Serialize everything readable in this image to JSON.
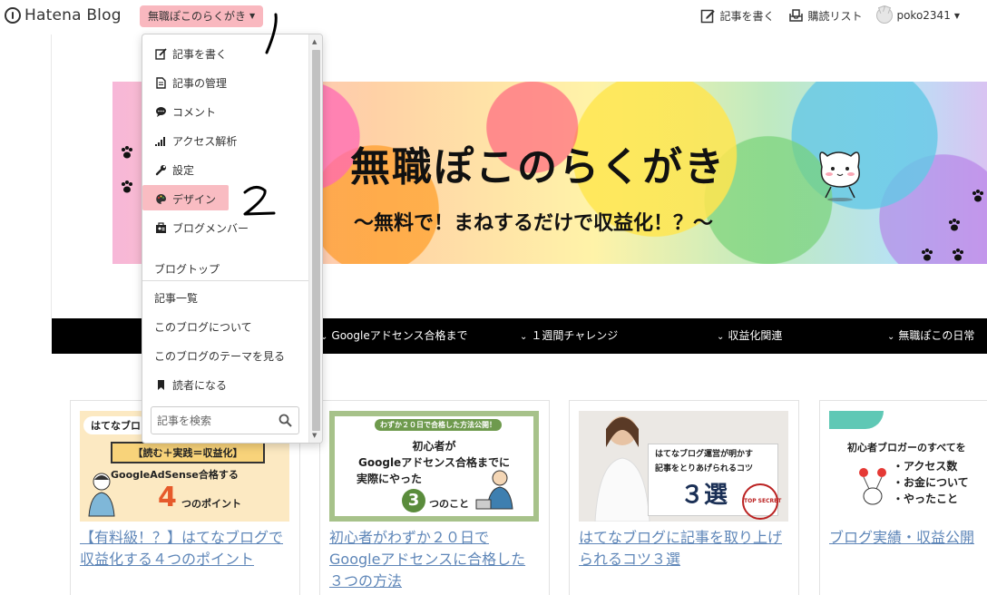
{
  "topbar": {
    "logo_text": "Hatena Blog",
    "blog_switch_label": "無職ぽこのらくがき",
    "nav": {
      "write": "記事を書く",
      "reading_list": "購読リスト",
      "username": "poko2341"
    }
  },
  "banner": {
    "title": "無職ぽこのらくがき",
    "subtitle": "〜無料で！まねするだけで収益化！？〜"
  },
  "category_nav": [
    "Googleアドセンス合格まで",
    "１週間チャレンジ",
    "収益化関連",
    "無職ぽこの日常"
  ],
  "dropdown": {
    "admin_items": [
      {
        "label": "記事を書く",
        "icon": "edit-icon"
      },
      {
        "label": "記事の管理",
        "icon": "document-icon"
      },
      {
        "label": "コメント",
        "icon": "comment-icon"
      },
      {
        "label": "アクセス解析",
        "icon": "bar-chart-icon"
      },
      {
        "label": "設定",
        "icon": "wrench-icon"
      },
      {
        "label": "デザイン",
        "icon": "palette-icon"
      },
      {
        "label": "ブログメンバー",
        "icon": "members-icon"
      }
    ],
    "blog_items": [
      "ブログトップ",
      "記事一覧",
      "このブログについて",
      "このブログのテーマを見る"
    ],
    "subscribe_label": "読者になる",
    "search_placeholder": "記事を検索"
  },
  "cards": [
    {
      "title": "【有料級！？】はてなブログで収益化する４つのポイント",
      "thumb_lines": [
        "はてなブロ",
        "【読む＋実践＝収益化】",
        "GoogleAdSense合格する",
        "4",
        "つのポイント"
      ]
    },
    {
      "title": "初心者がわずか２０日でGoogleアドセンスに合格した３つの方法",
      "thumb_lines": [
        "わずか２０日で合格した方法公開！",
        "初心者が",
        "Googleアドセンス合格までに",
        "実際にやった",
        "3",
        "つのこと"
      ]
    },
    {
      "title": "はてなブログに記事を取り上げられるコツ３選",
      "thumb_lines": [
        "はてなブログ運営が明かす",
        "記事をとりあげられるコツ",
        "３選",
        "TOP SECRET"
      ]
    },
    {
      "title": "ブログ実績・収益公開",
      "thumb_lines": [
        "初心者ブロガーのすべてを",
        "・アクセス数",
        "・お金について",
        "・やったこと"
      ]
    }
  ],
  "annotations": [
    "1",
    "2"
  ],
  "colors": {
    "highlight_pink": "#f9b8bf",
    "link_blue": "#5e86b8",
    "nav_black": "#000000"
  }
}
